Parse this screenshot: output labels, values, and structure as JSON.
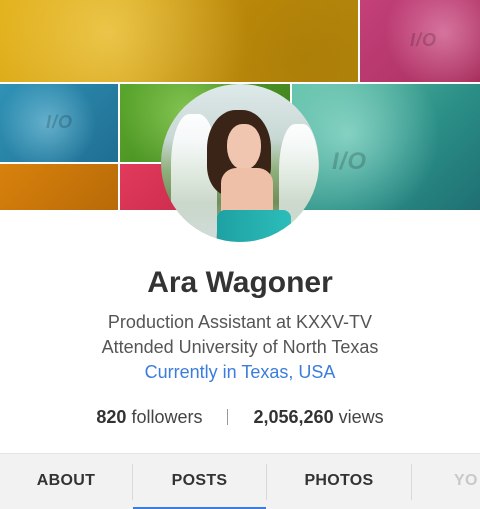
{
  "cover": {
    "tile_marks": [
      "I/O",
      "I/O",
      "I/O",
      "I/O"
    ]
  },
  "profile": {
    "name": "Ara Wagoner",
    "occupation": "Production Assistant at KXXV-TV",
    "education": "Attended University of North Texas",
    "location": "Currently in Texas, USA"
  },
  "stats": {
    "followers_count": "820",
    "followers_label": "followers",
    "views_count": "2,056,260",
    "views_label": "views"
  },
  "tabs": [
    {
      "label": "ABOUT"
    },
    {
      "label": "POSTS"
    },
    {
      "label": "PHOTOS"
    },
    {
      "label": "YO"
    }
  ],
  "colors": {
    "accent": "#3b7ddd",
    "tab_bar": "#f2f2f2",
    "text_primary": "#333333",
    "text_secondary": "#555555"
  },
  "active_tab": "POSTS"
}
